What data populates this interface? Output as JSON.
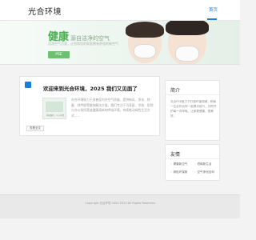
{
  "header": {
    "logo": "光合环境",
    "nav": {
      "home": "首页"
    }
  },
  "banner": {
    "title_big": "健康",
    "title_rest": "源自洁净的空气",
    "desc": "洁净空气方案，让您和您的家庭拥有舒适的新空气",
    "button": "PSE"
  },
  "post": {
    "title": "欢迎来到光合环境，2025 我们又见面了",
    "thumb_caption": "环境保护，人人有责",
    "excerpt": "光合环境致力于改善室内外空气质量，提供新风、净化、除霾、除甲醛等整体解决方案。我们专注于为家庭、学校、医院与办公场所营造健康清新的呼吸环境，持续推动绿色生活方式……",
    "read_more": "查看全文"
  },
  "sidebar": {
    "about": {
      "title": "简介",
      "text": "光合PSE致力于打造环保领域，和每一位合作伙伴一起携手前行，共同守护每一次呼吸，让家更健康、更美好。"
    },
    "links": {
      "title": "友情",
      "items": [
        "健康新空气",
        "低碳新生活",
        "绿色环保家",
        "空气净化百科"
      ]
    }
  },
  "footer": {
    "copyright": "Copyright 光合环境 2004-2025 All Rights Reserved"
  }
}
